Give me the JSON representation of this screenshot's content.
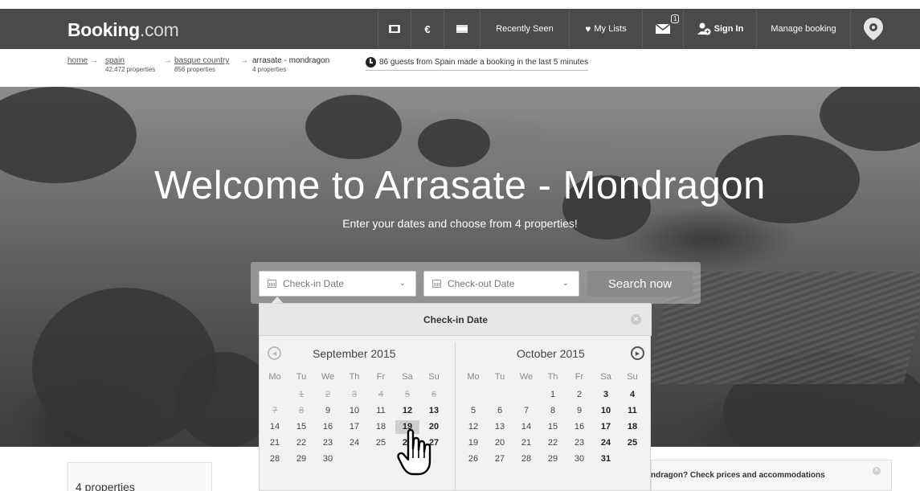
{
  "header": {
    "brand_main": "Booking",
    "brand_tld": ".com",
    "currency": "€",
    "recently_seen": "Recently Seen",
    "my_lists": "My Lists",
    "inbox_count": "1",
    "sign_in": "Sign In",
    "manage_booking": "Manage booking"
  },
  "breadcrumb": {
    "items": [
      {
        "label": "home",
        "count": ""
      },
      {
        "label": "spain",
        "count": "42,472 properties"
      },
      {
        "label": "basque country",
        "count": "856 properties"
      },
      {
        "label": "arrasate - mondragon",
        "count": "4 properties"
      }
    ],
    "arrow": "→"
  },
  "activity": {
    "text": "86 guests from Spain made a booking in the last 5 minutes"
  },
  "hero": {
    "title": "Welcome to Arrasate - Mondragon",
    "subtitle": "Enter your dates and choose from 4 properties!"
  },
  "search": {
    "checkin_placeholder": "Check-in Date",
    "checkout_placeholder": "Check-out Date",
    "button": "Search now"
  },
  "calendar": {
    "title": "Check-in Date",
    "weekdays": [
      "Mo",
      "Tu",
      "We",
      "Th",
      "Fr",
      "Sa",
      "Su"
    ],
    "months": [
      {
        "name": "September 2015",
        "rows": [
          [
            "",
            "1",
            "2",
            "3",
            "4",
            "5",
            "6"
          ],
          [
            "7",
            "8",
            "9",
            "10",
            "11",
            "12",
            "13"
          ],
          [
            "14",
            "15",
            "16",
            "17",
            "18",
            "19",
            "20"
          ],
          [
            "21",
            "22",
            "23",
            "24",
            "25",
            "26",
            "27"
          ],
          [
            "28",
            "29",
            "30",
            "",
            "",
            "",
            ""
          ]
        ],
        "past_days": [
          "1",
          "2",
          "3",
          "4",
          "5",
          "6",
          "7",
          "8"
        ],
        "hovered_day": "19"
      },
      {
        "name": "October 2015",
        "rows": [
          [
            "",
            "",
            "",
            "1",
            "2",
            "3",
            "4"
          ],
          [
            "5",
            "6",
            "7",
            "8",
            "9",
            "10",
            "11"
          ],
          [
            "12",
            "13",
            "14",
            "15",
            "16",
            "17",
            "18"
          ],
          [
            "19",
            "20",
            "21",
            "22",
            "23",
            "24",
            "25"
          ],
          [
            "26",
            "27",
            "28",
            "29",
            "30",
            "31",
            ""
          ]
        ],
        "past_days": [],
        "hovered_day": ""
      }
    ]
  },
  "results": {
    "count_label": "4 properties"
  },
  "banner": {
    "text": "ndragon? Check prices and accommodations"
  },
  "colors": {
    "topbar": "#4a4a4a",
    "search_button": "#8a8a8a",
    "calendar_bg": "#f2f2f2"
  }
}
